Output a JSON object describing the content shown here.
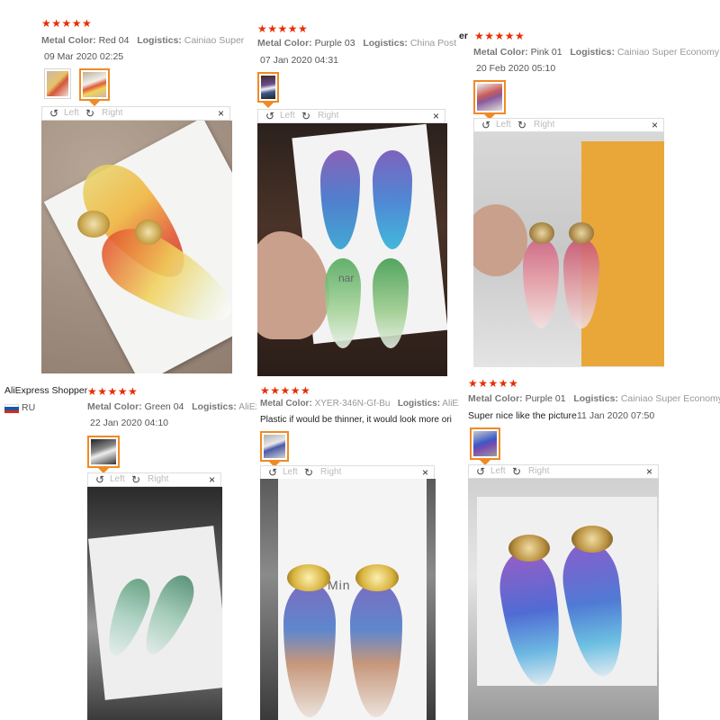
{
  "stars": "★★★★★",
  "labels": {
    "metal_color": "Metal Color:",
    "logistics": "Logistics:"
  },
  "toolbar": {
    "left": "Left",
    "right": "Right",
    "close": "×",
    "rotate_left_icon": "↺",
    "rotate_right_icon": "↻"
  },
  "reviews": [
    {
      "metal": "Red 04",
      "logistics": "Cainiao Super Econo",
      "date": "09 Mar 2020 02:25"
    },
    {
      "metal": "Purple 03",
      "logistics": "China Post Regi",
      "date": "07 Jan 2020 04:31"
    },
    {
      "prefix": "er",
      "metal": "Pink 01",
      "logistics": "Cainiao Super Economy Glob",
      "date": "20 Feb 2020 05:10"
    },
    {
      "shopper": "AliExpress Shopper",
      "country": "RU",
      "metal": "Green 04",
      "logistics": "AliExpr",
      "date": "22 Jan 2020 04:10"
    },
    {
      "metal": "XYER-346N-Gf-Bu",
      "logistics": "AliExpre",
      "text": "Plastic if would be thinner, it would look more ori"
    },
    {
      "metal": "Purple 01",
      "logistics": "Cainiao Super Economy Glob",
      "text": "Super nice like the picture",
      "date": "11 Jan 2020 07:50"
    }
  ],
  "card_text": {
    "mina": "Min",
    "nar": "nar"
  },
  "colors": {
    "star": "#e62e04",
    "selected_thumb": "#f08a24"
  }
}
